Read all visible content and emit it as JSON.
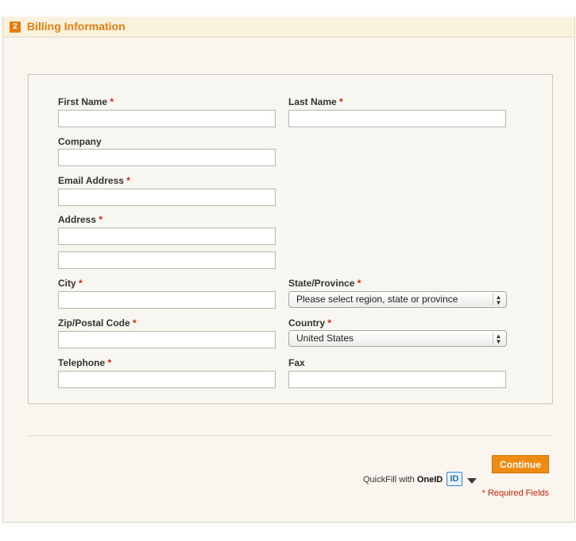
{
  "section": {
    "step": "2",
    "title": "Billing Information"
  },
  "form": {
    "required_mark": "*",
    "first_name": {
      "label": "First Name",
      "value": ""
    },
    "last_name": {
      "label": "Last Name",
      "value": ""
    },
    "company": {
      "label": "Company",
      "value": ""
    },
    "email": {
      "label": "Email Address",
      "value": ""
    },
    "address": {
      "label": "Address",
      "line1": "",
      "line2": ""
    },
    "city": {
      "label": "City",
      "value": ""
    },
    "state": {
      "label": "State/Province",
      "selected": "Please select region, state or province"
    },
    "zip": {
      "label": "Zip/Postal Code",
      "value": ""
    },
    "country": {
      "label": "Country",
      "selected": "United States"
    },
    "telephone": {
      "label": "Telephone",
      "value": ""
    },
    "fax": {
      "label": "Fax",
      "value": ""
    }
  },
  "footer": {
    "quickfill_prefix": "QuickFill with ",
    "quickfill_brand": "OneID",
    "oneid_icon_text": "ID",
    "continue_label": "Continue",
    "required_note": "* Required Fields"
  },
  "colors": {
    "accent": "#ef8a12",
    "required": "#d7220d",
    "panel": "#faf6ef"
  }
}
